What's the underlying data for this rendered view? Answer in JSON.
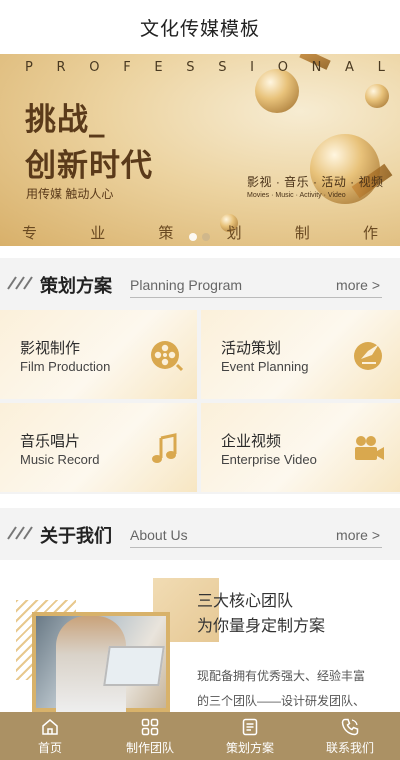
{
  "header": {
    "title": "文化传媒模板"
  },
  "banner": {
    "professional_letters": [
      "P",
      "R",
      "O",
      "F",
      "E",
      "S",
      "S",
      "I",
      "O",
      "N",
      "A",
      "L"
    ],
    "headline_line1": "挑战_",
    "headline_line2": "创新时代",
    "slogan": "用传媒 触动人心",
    "categories_cn": "影视 · 音乐 · 活动 · 视频",
    "categories_en": "Movies · Music · Activity · Video",
    "bottom_chars": [
      "专",
      "业",
      "策",
      "划",
      "制",
      "作"
    ],
    "active_slide": 1,
    "slide_count": 2
  },
  "planning": {
    "title_cn": "策划方案",
    "title_en": "Planning Program",
    "more": "more >",
    "cards": [
      {
        "cn": "影视制作",
        "en": "Film Production",
        "icon": "film-reel-icon"
      },
      {
        "cn": "活动策划",
        "en": "Event Planning",
        "icon": "event-planning-icon"
      },
      {
        "cn": "音乐唱片",
        "en": "Music Record",
        "icon": "music-note-icon"
      },
      {
        "cn": "企业视频",
        "en": "Enterprise Video",
        "icon": "video-camera-icon"
      }
    ]
  },
  "about": {
    "title_cn": "关于我们",
    "title_en": "About Us",
    "more": "more >",
    "heading_line1": "三大核心团队",
    "heading_line2": "为你量身定制方案",
    "para_line1": "现配备拥有优秀强大、经验丰富",
    "para_line2": "的三个团队——设计研发团队、"
  },
  "nav": {
    "items": [
      {
        "label": "首页",
        "icon": "home-icon"
      },
      {
        "label": "制作团队",
        "icon": "grid-icon"
      },
      {
        "label": "策划方案",
        "icon": "document-icon"
      },
      {
        "label": "联系我们",
        "icon": "phone-icon"
      }
    ]
  },
  "colors": {
    "accent": "#ab9164",
    "gold": "#d8b06a",
    "dark_brown": "#5a3a1a"
  }
}
